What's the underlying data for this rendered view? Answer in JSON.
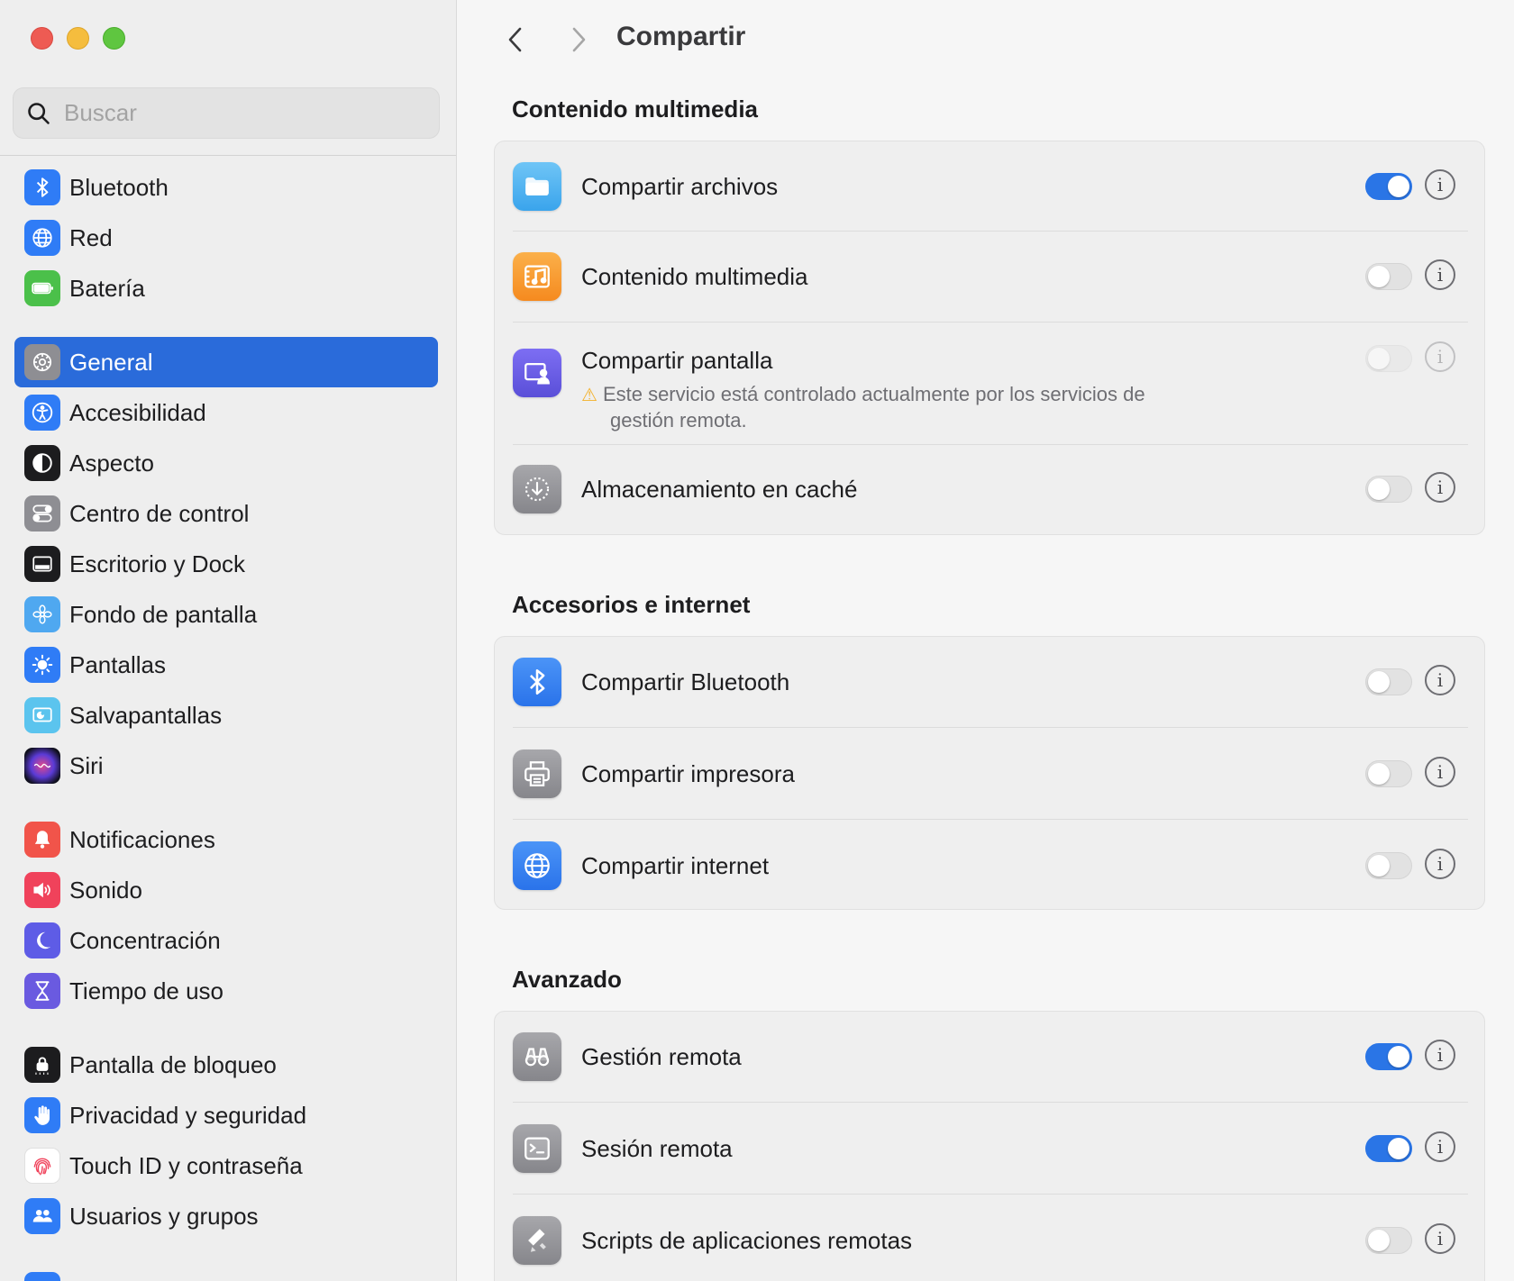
{
  "search": {
    "placeholder": "Buscar"
  },
  "sidebar": {
    "items": [
      {
        "label": "Bluetooth",
        "icon": "bluetooth-icon",
        "color": "#2f7cf6"
      },
      {
        "label": "Red",
        "icon": "globe-icon",
        "color": "#2f7cf6"
      },
      {
        "label": "Batería",
        "icon": "battery-icon",
        "color": "#4bc04a"
      },
      {
        "label": "General",
        "icon": "gear-icon",
        "color": "#8e8e93"
      },
      {
        "label": "Accesibilidad",
        "icon": "accessibility-icon",
        "color": "#2f7cf6"
      },
      {
        "label": "Aspecto",
        "icon": "appearance-icon",
        "color": "#1c1c1e"
      },
      {
        "label": "Centro de control",
        "icon": "control-center-icon",
        "color": "#8e8e93"
      },
      {
        "label": "Escritorio y Dock",
        "icon": "dock-icon",
        "color": "#1c1c1e"
      },
      {
        "label": "Fondo de pantalla",
        "icon": "wallpaper-icon",
        "color": "#4fa8f0"
      },
      {
        "label": "Pantallas",
        "icon": "sun-icon",
        "color": "#2f7cf6"
      },
      {
        "label": "Salvapantallas",
        "icon": "screensaver-icon",
        "color": "#5bc4ee"
      },
      {
        "label": "Siri",
        "icon": "siri-icon",
        "color": "#3a2f6b"
      },
      {
        "label": "Notificaciones",
        "icon": "bell-icon",
        "color": "#f1544a"
      },
      {
        "label": "Sonido",
        "icon": "speaker-icon",
        "color": "#f0425b"
      },
      {
        "label": "Concentración",
        "icon": "moon-icon",
        "color": "#5e5ce6"
      },
      {
        "label": "Tiempo de uso",
        "icon": "hourglass-icon",
        "color": "#6a5ae0"
      },
      {
        "label": "Pantalla de bloqueo",
        "icon": "lock-icon",
        "color": "#1c1c1e"
      },
      {
        "label": "Privacidad y seguridad",
        "icon": "hand-icon",
        "color": "#2f7cf6"
      },
      {
        "label": "Touch ID y contraseña",
        "icon": "fingerprint-icon",
        "color": "#ffffff"
      },
      {
        "label": "Usuarios y grupos",
        "icon": "users-icon",
        "color": "#2f7cf6"
      }
    ],
    "selected_index": 3
  },
  "header": {
    "title": "Compartir"
  },
  "sections": [
    {
      "title": "Contenido multimedia",
      "rows": [
        {
          "label": "Compartir archivos",
          "on": true,
          "enabled": true,
          "icon": "folder-icon"
        },
        {
          "label": "Contenido multimedia",
          "on": false,
          "enabled": true,
          "icon": "media-icon"
        },
        {
          "label": "Compartir pantalla",
          "on": false,
          "enabled": false,
          "icon": "screen-share-icon",
          "note": "Este servicio está controlado actualmente por los servicios de gestión remota."
        },
        {
          "label": "Almacenamiento en caché",
          "on": false,
          "enabled": true,
          "icon": "cache-icon"
        }
      ]
    },
    {
      "title": "Accesorios e internet",
      "rows": [
        {
          "label": "Compartir Bluetooth",
          "on": false,
          "enabled": true,
          "icon": "bluetooth-icon"
        },
        {
          "label": "Compartir impresora",
          "on": false,
          "enabled": true,
          "icon": "printer-icon"
        },
        {
          "label": "Compartir internet",
          "on": false,
          "enabled": true,
          "icon": "globe-icon"
        }
      ]
    },
    {
      "title": "Avanzado",
      "rows": [
        {
          "label": "Gestión remota",
          "on": true,
          "enabled": true,
          "icon": "binoculars-icon"
        },
        {
          "label": "Sesión remota",
          "on": true,
          "enabled": true,
          "icon": "terminal-icon"
        },
        {
          "label": "Scripts de aplicaciones remotas",
          "on": false,
          "enabled": true,
          "icon": "script-icon"
        }
      ]
    }
  ],
  "colors": {
    "accent": "#2a6bda",
    "toggle_on": "#2a75e6",
    "warning": "#f3b12a"
  }
}
